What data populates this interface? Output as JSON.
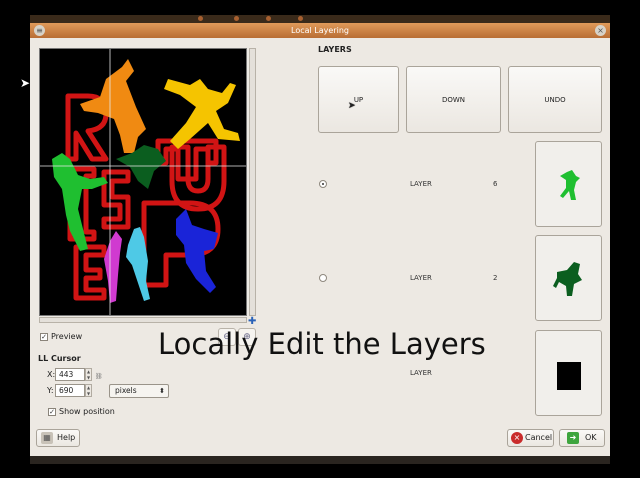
{
  "window": {
    "title": "Local Layering"
  },
  "preview": {
    "label": "Preview",
    "checked": true
  },
  "cursor": {
    "heading": "LL Cursor",
    "x_label": "X:",
    "x_value": "443",
    "y_label": "Y:",
    "y_value": "690",
    "unit": "pixels",
    "show_position_label": "Show position",
    "show_position_checked": true
  },
  "layers": {
    "heading": "LAYERS",
    "up_label": "UP",
    "down_label": "DOWN",
    "undo_label": "UNDO",
    "rows": [
      {
        "label": "LAYER",
        "number": "6",
        "selected": true
      },
      {
        "label": "LAYER",
        "number": "2",
        "selected": false
      },
      {
        "label": "LAYER",
        "number": "",
        "selected": false
      }
    ]
  },
  "caption": "Locally Edit the Layers",
  "footer": {
    "help_label": "Help",
    "cancel_label": "Cancel",
    "ok_label": "OK"
  },
  "colors": {
    "title_orange": "#d8884b",
    "layer_green": "#1fbf30",
    "layer_dark_green": "#0b5e1f",
    "preview_red": "#d11414",
    "preview_blue": "#1a24d8",
    "preview_yellow": "#f5c400",
    "preview_orange": "#f08a12"
  },
  "icons": {
    "help_icon": "grid-help",
    "cancel_icon": "x-circle",
    "ok_icon": "green-arrow",
    "zoom_out_icon": "magnifier-minus",
    "zoom_in_icon": "magnifier-plus"
  }
}
